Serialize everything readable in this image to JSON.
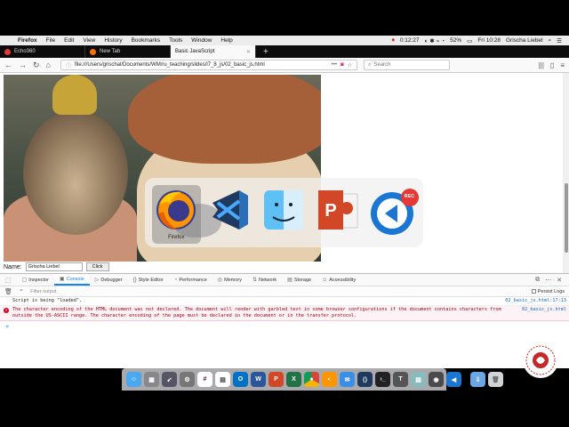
{
  "menubar": {
    "app_name": "Firefox",
    "items": [
      "File",
      "Edit",
      "View",
      "History",
      "Bookmarks",
      "Tools",
      "Window",
      "Help"
    ],
    "time_counter": "0:12:27",
    "battery": "52%",
    "clock": "Fri 10:28",
    "user": "Grischa Liebel"
  },
  "tabs": [
    {
      "label": "Echo360",
      "color": "#e53935"
    },
    {
      "label": "New Tab",
      "color": "#ff6f00"
    },
    {
      "label": "Basic JavaScript",
      "color": "#9e9e9e"
    }
  ],
  "navbar": {
    "url": "file:///Users/grischal/Documents/WM/ru_teaching/slides/l7_8_js/02_basic_js.html",
    "search_placeholder": "Search"
  },
  "page": {
    "name_label": "Name:",
    "name_value": "Grischa Liebel",
    "click_label": "Click"
  },
  "switcher": {
    "apps": [
      {
        "name": "firefox",
        "label": "Firefox",
        "selected": true
      },
      {
        "name": "vscode",
        "label": "",
        "selected": false
      },
      {
        "name": "finder",
        "label": "",
        "selected": false
      },
      {
        "name": "powerpoint",
        "label": "",
        "selected": false
      },
      {
        "name": "echo360-capture",
        "label": "",
        "badge": "REC",
        "selected": false
      }
    ]
  },
  "devtools": {
    "tabs": [
      {
        "label": "Inspector",
        "icon": "inspector-icon",
        "active": false
      },
      {
        "label": "Console",
        "icon": "console-icon",
        "active": true
      },
      {
        "label": "Debugger",
        "icon": "debugger-icon",
        "active": false
      },
      {
        "label": "Style Editor",
        "icon": "style-icon",
        "active": false
      },
      {
        "label": "Performance",
        "icon": "performance-icon",
        "active": false
      },
      {
        "label": "Memory",
        "icon": "memory-icon",
        "active": false
      },
      {
        "label": "Network",
        "icon": "network-icon",
        "active": false
      },
      {
        "label": "Storage",
        "icon": "storage-icon",
        "active": false
      },
      {
        "label": "Accessibility",
        "icon": "accessibility-icon",
        "active": false
      }
    ],
    "filter_placeholder": "Filter output",
    "persist_logs": "Persist Logs"
  },
  "console": {
    "logs": [
      {
        "type": "log",
        "message": "Script is being \"loaded\".",
        "source": "02_basic_js.html:17:13"
      },
      {
        "type": "error",
        "message": "The character encoding of the HTML document was not declared. The document will render with garbled text in some browser configurations if the document contains characters from outside the US-ASCII range. The character encoding of the page must be declared in the document or in the transfer protocol.",
        "source": "02_basic_js.html"
      }
    ],
    "prompt": "»"
  },
  "dock": {
    "apps": [
      "finder",
      "launchpad",
      "rocket",
      "system-preferences",
      "slack",
      "calendar",
      "outlook",
      "word",
      "powerpoint",
      "excel",
      "chrome",
      "firefox",
      "mail",
      "vscode",
      "terminal",
      "latex",
      "preview",
      "camera",
      "echo360",
      "downloads",
      "trash"
    ]
  }
}
